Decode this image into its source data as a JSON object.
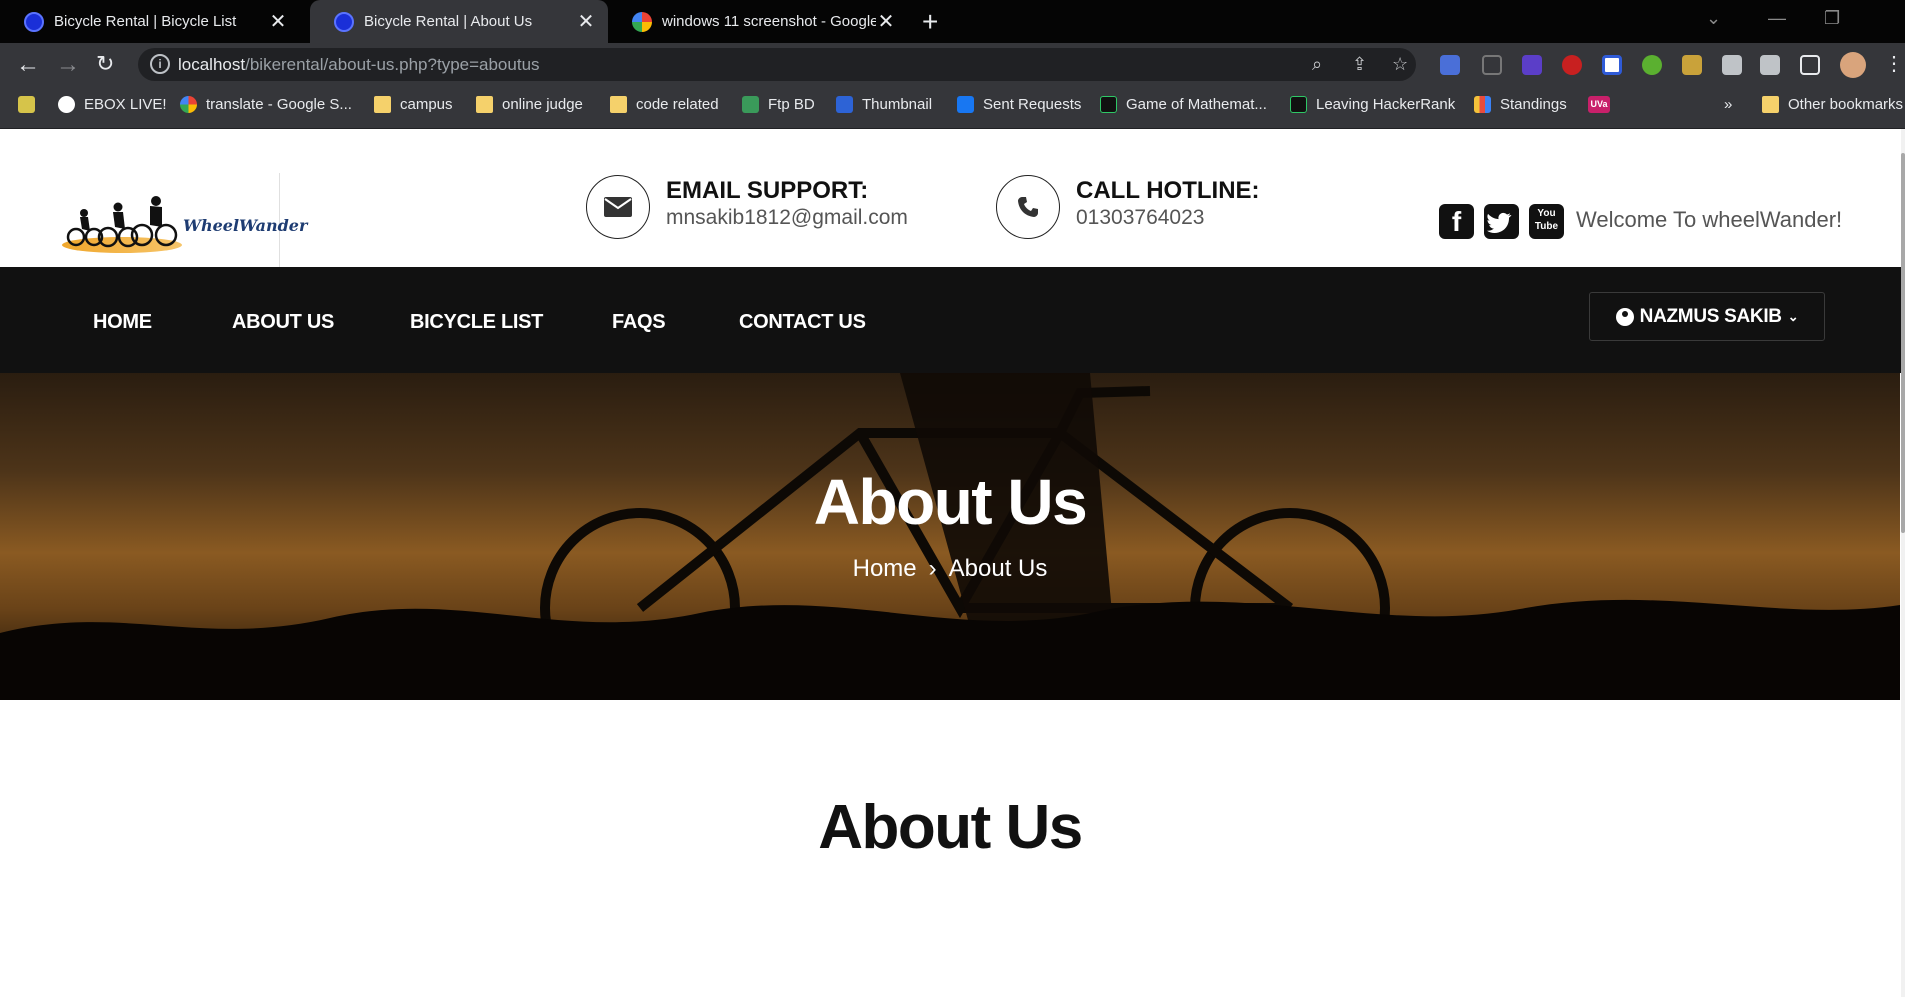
{
  "browser": {
    "tabs": [
      {
        "title": "Bicycle Rental | Bicycle List",
        "icon": "bike-favicon-icon"
      },
      {
        "title": "Bicycle Rental | About Us",
        "icon": "bike-favicon-icon",
        "active": true
      },
      {
        "title": "windows 11 screenshot - Google",
        "icon": "google-favicon-icon"
      }
    ],
    "url_host": "localhost",
    "url_path": "/bikerental/about-us.php?type=aboutus",
    "bookmarks": [
      "EBOX LIVE!",
      "translate - Google S...",
      "campus",
      "online judge",
      "code related",
      "Ftp BD",
      "Thumbnail",
      "Sent Requests",
      "Game of Mathemat...",
      "Leaving HackerRank",
      "Standings",
      "UVa"
    ],
    "other_bookmarks": "Other bookmarks"
  },
  "header": {
    "logo_text": "WheelWander",
    "email": {
      "label": "EMAIL SUPPORT:",
      "value": "mnsakib1812@gmail.com"
    },
    "hotline": {
      "label": "CALL HOTLINE:",
      "value": "01303764023"
    },
    "welcome": "Welcome To wheelWander!"
  },
  "nav": {
    "items": [
      "HOME",
      "ABOUT US",
      "BICYCLE LIST",
      "FAQS",
      "CONTACT US"
    ],
    "user": "NAZMUS SAKIB"
  },
  "hero": {
    "title": "About Us",
    "crumb_home": "Home",
    "crumb_current": "About Us"
  },
  "section": {
    "title": "About Us"
  },
  "colors": {
    "accent_dark": "#111111",
    "browser_bg": "#35363a",
    "logo_orange": "#f0a72c"
  }
}
